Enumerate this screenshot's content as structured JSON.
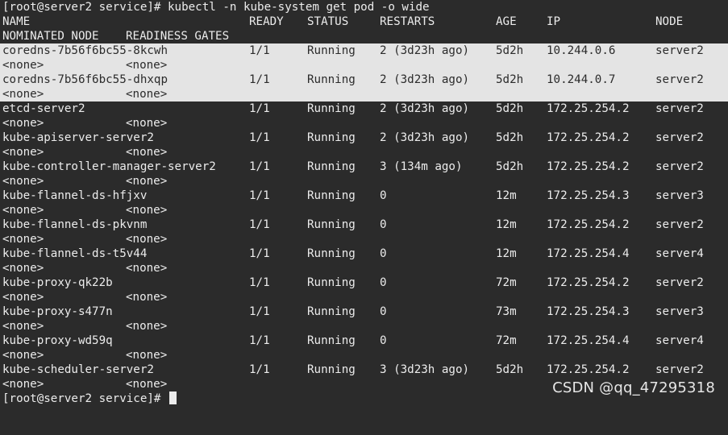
{
  "prompt_command": "[root@server2 service]# kubectl -n kube-system get pod -o wide",
  "header": {
    "name": "NAME",
    "ready": "READY",
    "status": "STATUS",
    "restarts": "RESTARTS",
    "age": "AGE",
    "ip": "IP",
    "node": "NODE",
    "nominated_node": "NOMINATED NODE",
    "readiness_gates": "READINESS GATES"
  },
  "pods": [
    {
      "name": "coredns-7b56f6bc55-8kcwh",
      "ready": "1/1",
      "status": "Running",
      "restarts": "2 (3d23h ago)",
      "age": "5d2h",
      "ip": "10.244.0.6",
      "node": "server2",
      "nominated": "<none>",
      "gates": "<none>",
      "highlighted": true
    },
    {
      "name": "coredns-7b56f6bc55-dhxqp",
      "ready": "1/1",
      "status": "Running",
      "restarts": "2 (3d23h ago)",
      "age": "5d2h",
      "ip": "10.244.0.7",
      "node": "server2",
      "nominated": "<none>",
      "gates": "<none>",
      "highlighted": true
    },
    {
      "name": "etcd-server2",
      "ready": "1/1",
      "status": "Running",
      "restarts": "2 (3d23h ago)",
      "age": "5d2h",
      "ip": "172.25.254.2",
      "node": "server2",
      "nominated": "<none>",
      "gates": "<none>",
      "highlighted": false
    },
    {
      "name": "kube-apiserver-server2",
      "ready": "1/1",
      "status": "Running",
      "restarts": "2 (3d23h ago)",
      "age": "5d2h",
      "ip": "172.25.254.2",
      "node": "server2",
      "nominated": "<none>",
      "gates": "<none>",
      "highlighted": false
    },
    {
      "name": "kube-controller-manager-server2",
      "ready": "1/1",
      "status": "Running",
      "restarts": "3 (134m ago)",
      "age": "5d2h",
      "ip": "172.25.254.2",
      "node": "server2",
      "nominated": "<none>",
      "gates": "<none>",
      "highlighted": false
    },
    {
      "name": "kube-flannel-ds-hfjxv",
      "ready": "1/1",
      "status": "Running",
      "restarts": "0",
      "age": "12m",
      "ip": "172.25.254.3",
      "node": "server3",
      "nominated": "<none>",
      "gates": "<none>",
      "highlighted": false
    },
    {
      "name": "kube-flannel-ds-pkvnm",
      "ready": "1/1",
      "status": "Running",
      "restarts": "0",
      "age": "12m",
      "ip": "172.25.254.2",
      "node": "server2",
      "nominated": "<none>",
      "gates": "<none>",
      "highlighted": false
    },
    {
      "name": "kube-flannel-ds-t5v44",
      "ready": "1/1",
      "status": "Running",
      "restarts": "0",
      "age": "12m",
      "ip": "172.25.254.4",
      "node": "server4",
      "nominated": "<none>",
      "gates": "<none>",
      "highlighted": false
    },
    {
      "name": "kube-proxy-qk22b",
      "ready": "1/1",
      "status": "Running",
      "restarts": "0",
      "age": "72m",
      "ip": "172.25.254.2",
      "node": "server2",
      "nominated": "<none>",
      "gates": "<none>",
      "highlighted": false
    },
    {
      "name": "kube-proxy-s477n",
      "ready": "1/1",
      "status": "Running",
      "restarts": "0",
      "age": "73m",
      "ip": "172.25.254.3",
      "node": "server3",
      "nominated": "<none>",
      "gates": "<none>",
      "highlighted": false
    },
    {
      "name": "kube-proxy-wd59q",
      "ready": "1/1",
      "status": "Running",
      "restarts": "0",
      "age": "72m",
      "ip": "172.25.254.4",
      "node": "server4",
      "nominated": "<none>",
      "gates": "<none>",
      "highlighted": false
    },
    {
      "name": "kube-scheduler-server2",
      "ready": "1/1",
      "status": "Running",
      "restarts": "3 (3d23h ago)",
      "age": "5d2h",
      "ip": "172.25.254.2",
      "node": "server2",
      "nominated": "<none>",
      "gates": "<none>",
      "highlighted": false
    }
  ],
  "final_prompt": "[root@server2 service]#",
  "watermark": "CSDN @qq_47295318",
  "colors": {
    "background": "#2b2b2b",
    "foreground": "#ececec",
    "selection": "#e4e4e4"
  }
}
